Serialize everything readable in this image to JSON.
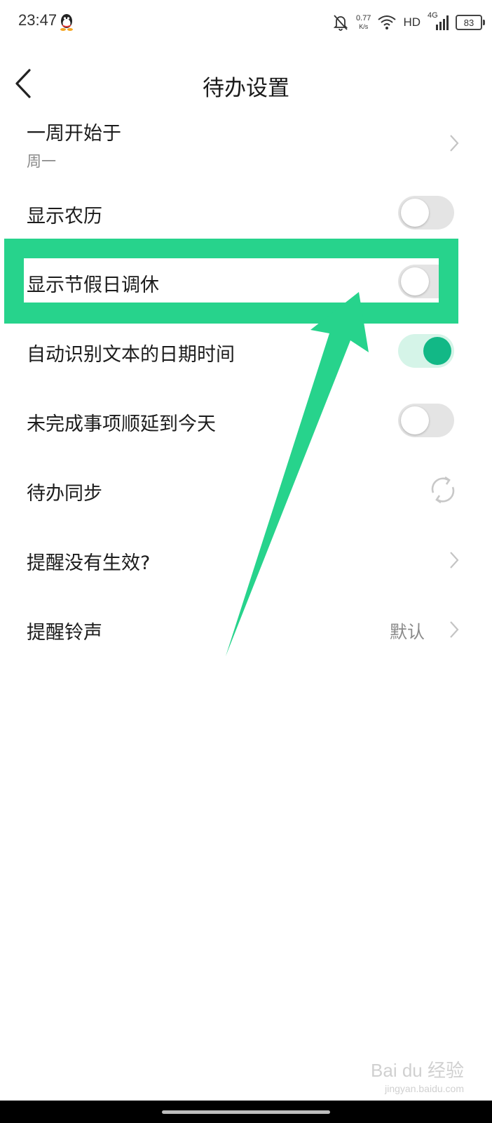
{
  "status_bar": {
    "time": "23:47",
    "network_speed_value": "0.77",
    "network_speed_unit": "K/s",
    "hd_label": "HD",
    "network_type": "4G",
    "battery_level": "83"
  },
  "header": {
    "title": "待办设置"
  },
  "settings": {
    "week_start": {
      "label": "一周开始于",
      "value": "周一"
    },
    "show_lunar": {
      "label": "显示农历",
      "enabled": false
    },
    "show_holidays": {
      "label": "显示节假日调休",
      "enabled": false
    },
    "auto_detect_datetime": {
      "label": "自动识别文本的日期时间",
      "enabled": true
    },
    "postpone_unfinished": {
      "label": "未完成事项顺延到今天",
      "enabled": false
    },
    "sync": {
      "label": "待办同步"
    },
    "reminder_not_working": {
      "label": "提醒没有生效?"
    },
    "reminder_ringtone": {
      "label": "提醒铃声",
      "value": "默认"
    }
  },
  "watermark": {
    "brand": "Bai du 经验",
    "url": "jingyan.baidu.com"
  },
  "colors": {
    "accent": "#12b886",
    "highlight": "#27d38c",
    "toggle_off": "#e4e4e4"
  }
}
